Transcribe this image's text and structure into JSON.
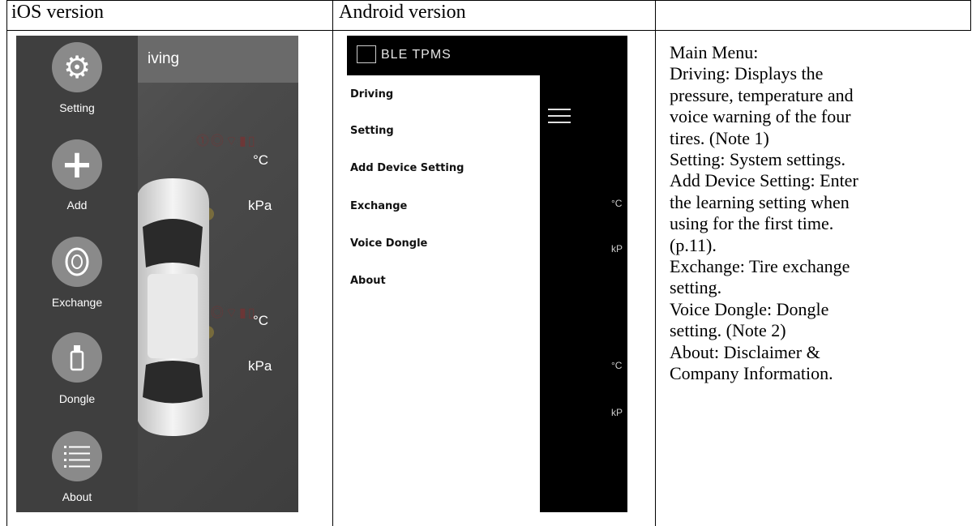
{
  "headers": {
    "ios": "iOS version",
    "android": "Android version",
    "third": ""
  },
  "ios": {
    "header_title_fragment": "iving",
    "menu": [
      {
        "label": "Setting",
        "icon": "gear-icon"
      },
      {
        "label": "Add",
        "icon": "plus-icon"
      },
      {
        "label": "Exchange",
        "icon": "tire-icon"
      },
      {
        "label": "Dongle",
        "icon": "dongle-icon"
      },
      {
        "label": "About",
        "icon": "list-icon"
      }
    ],
    "units": {
      "temp_1": "°C",
      "pressure_1": "kPa",
      "temp_2": "°C",
      "pressure_2": "kPa"
    }
  },
  "android": {
    "app_title": "BLE TPMS",
    "menu": [
      "Driving",
      "Setting",
      "Add  Device Setting",
      "Exchange",
      "Voice Dongle",
      "About"
    ],
    "units": {
      "a": "°C",
      "b": "kP",
      "c": "°C",
      "d": "kP"
    }
  },
  "description": {
    "lines": [
      "Main Menu:",
      "Driving: Displays the",
      "pressure, temperature and",
      "voice warning of the four",
      "tires. (Note 1)",
      "Setting: System settings.",
      "Add Device Setting: Enter",
      "the learning setting when",
      "using for the first time.",
      "(p.11).",
      "Exchange: Tire exchange",
      "setting.",
      "Voice Dongle: Dongle",
      "setting. (Note 2)",
      "About: Disclaimer &",
      "Company Information."
    ]
  },
  "colors": {
    "ios_bg": "#4a4a4a",
    "ios_button": "#8a8a8a",
    "android_bg": "#000000",
    "android_drawer": "#ffffff"
  }
}
